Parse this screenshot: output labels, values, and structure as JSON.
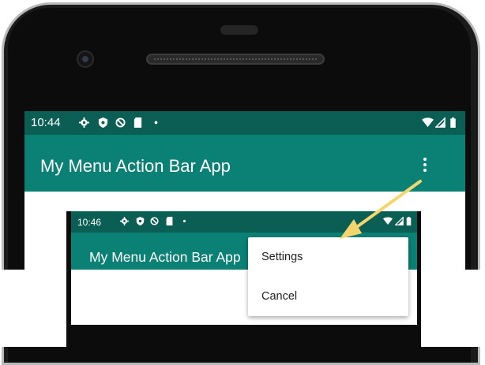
{
  "main_screen": {
    "status_bar": {
      "time": "10:44",
      "icons": [
        "settings-icon",
        "shield-icon",
        "do-not-disturb-icon",
        "sd-card-icon",
        "dot-icon",
        "wifi-icon",
        "signal-icon",
        "battery-icon"
      ]
    },
    "app_bar": {
      "title": "My Menu Action Bar App",
      "overflow_icon": "more-vert-icon"
    }
  },
  "inset_screen": {
    "status_bar": {
      "time": "10:46",
      "icons": [
        "settings-icon",
        "shield-icon",
        "do-not-disturb-icon",
        "sd-card-icon",
        "dot-icon",
        "wifi-icon",
        "signal-icon",
        "battery-icon"
      ]
    },
    "app_bar": {
      "title": "My Menu Action Bar App"
    },
    "overflow_menu": {
      "items": [
        {
          "label": "Settings"
        },
        {
          "label": "Cancel"
        }
      ]
    }
  },
  "colors": {
    "status_bar": "#0b5e54",
    "app_bar": "#0b8074",
    "arrow": "#f5d56e"
  }
}
